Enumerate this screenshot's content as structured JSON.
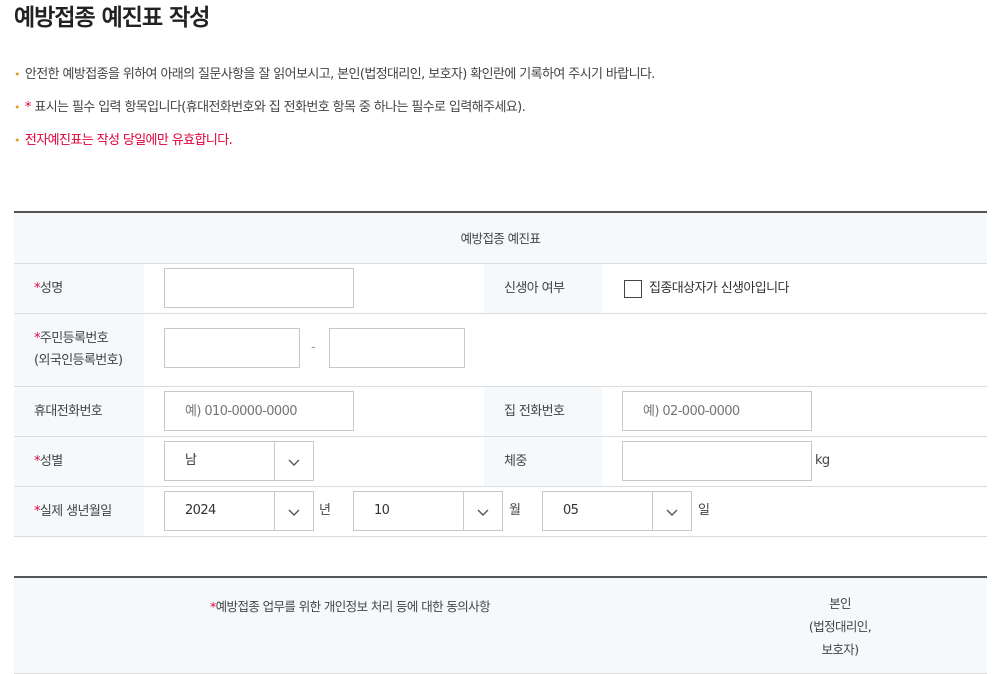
{
  "page": {
    "title": "예방접종 예진표 작성"
  },
  "notices": [
    {
      "text": "안전한 예방접종을 위하여 아래의 질문사항을 잘 읽어보시고, 본인(법정대리인, 보호자) 확인란에 기록하여 주시기 바랍니다."
    },
    {
      "star": "*",
      "text": " 표시는 필수 입력 항목입니다(휴대전화번호와 집 전화번호 항목 중 하나는 필수로 입력해주세요)."
    },
    {
      "text": "전자예진표는 작성 당일에만 유효합니다."
    }
  ],
  "form": {
    "header": "예방접종 예진표",
    "required_mark": "*",
    "name": {
      "label": "성명",
      "value": ""
    },
    "newborn": {
      "label": "신생아 여부",
      "checkbox_label": "집종대상자가 신생아입니다",
      "checked": false
    },
    "rrn": {
      "label_line1": "주민등록번호",
      "label_line2": "(외국인등록번호)",
      "part1": "",
      "dash": "-",
      "part2": ""
    },
    "mobile": {
      "label": "휴대전화번호",
      "placeholder": "예) 010-0000-0000"
    },
    "home_phone": {
      "label": "집 전화번호",
      "placeholder": "예) 02-000-0000"
    },
    "gender": {
      "label": "성별",
      "value": "남"
    },
    "weight": {
      "label": "체중",
      "value": "",
      "unit": "kg"
    },
    "birth": {
      "label": "실제 생년월일",
      "year": "2024",
      "year_unit": "년",
      "month": "10",
      "month_unit": "월",
      "day": "05",
      "day_unit": "일"
    }
  },
  "consent": {
    "title": "예방접종 업무를 위한 개인정보 처리 등에 대한 동의사항",
    "right_line1": "본인",
    "right_line2": "(법정대리인,",
    "right_line3": "보호자)"
  },
  "colors": {
    "required": "#e0003a",
    "bullet": "#e0a030",
    "header_bg": "#f6f9fc"
  },
  "icons": {
    "select_arrow": "chevron-down-icon"
  }
}
